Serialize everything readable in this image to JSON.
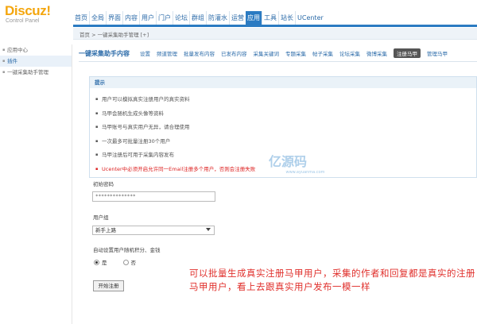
{
  "logo": {
    "title": "Discuz!",
    "subtitle": "Control Panel"
  },
  "nav": [
    "首页",
    "全局",
    "界面",
    "内容",
    "用户",
    "门户",
    "论坛",
    "群组",
    "防灌水",
    "运营",
    "应用",
    "工具",
    "站长",
    "UCenter"
  ],
  "nav_active_index": 10,
  "breadcrumb": "首页 > 一键采集助手管理 [+]",
  "sidebar": [
    {
      "label": "应用中心"
    },
    {
      "label": "插件"
    },
    {
      "label": "一键采集助手管理"
    }
  ],
  "sidebar_active_index": 1,
  "subnav": {
    "title": "一键采集助手内容",
    "tabs": [
      "设置",
      "频道管理",
      "批量发布内容",
      "已发布内容",
      "采集关键词",
      "专题采集",
      "帖子采集",
      "论坛采集",
      "微博采集",
      "注册马甲",
      "管理马甲"
    ],
    "active_index": 9
  },
  "tips": {
    "header": "提示",
    "items": [
      "用户可以模拟真实注册用户的真实资料",
      "马甲会随机生成头像等资料",
      "马甲账号与真实用户无异，请合理使用",
      "一次最多可批量注册30个用户",
      "马甲注册后可用于采集内容发布",
      "Ucenter中必须开启允许同一Email注册多个用户，否则会注册失败"
    ],
    "warn_index": 5
  },
  "form": {
    "password_label": "初始密码",
    "password_value": "**************",
    "group_label": "用户组",
    "group_selected": "新手上路",
    "random_label": "自动设置用户随机积分、金钱",
    "radio_yes": "是",
    "radio_no": "否",
    "submit_label": "开始注册"
  },
  "watermark": {
    "logo": "亿源码",
    "url": "www.ayuanma.com"
  },
  "annotation": "可以批量生成真实注册马甲用户，采集的作者和回复都是真实的注册马甲用户，看上去跟真实用户发布一模一样"
}
